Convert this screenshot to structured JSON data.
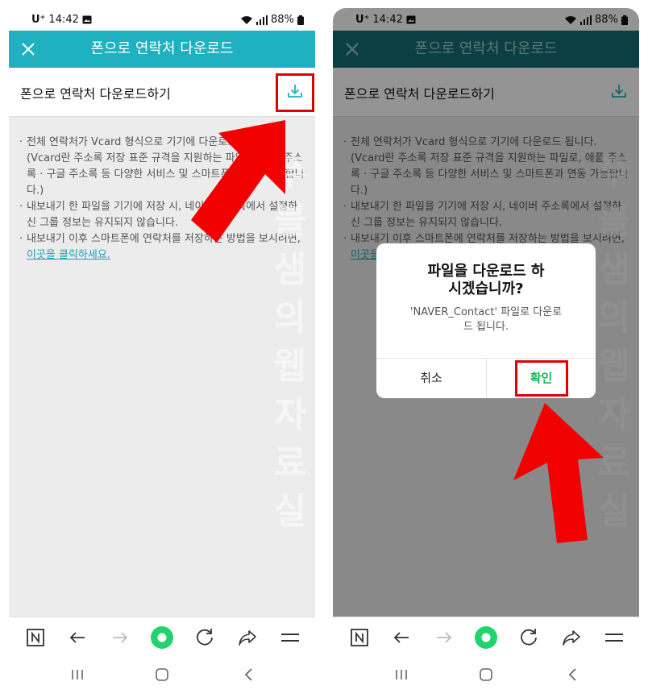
{
  "colors": {
    "accent": "#1fb1c0",
    "accent_dimmed": "#146d76",
    "link": "#1aa4b8",
    "confirm": "#11b956",
    "highlight": "#e00000",
    "home_circle": "#22d36b"
  },
  "status": {
    "carrier": "U⁺",
    "time": "14:42",
    "battery": "88%"
  },
  "appbar": {
    "title": "폰으로 연락처 다운로드",
    "close_icon": "close-icon"
  },
  "subheader": {
    "label": "폰으로 연락처 다운로드하기",
    "download_icon": "download-icon"
  },
  "content": {
    "bullet1": "전체 연락처가 Vcard 형식으로 기기에 다운로드 됩니다. (Vcard란 주소록 저장 표준 규격을 지원하는 파일로, 애플 주소록 · 구글 주소록 등 다양한 서비스 및 스마트폰과 연동 가능합니다.)",
    "bullet2": "내보내기 한 파일을 기기에 저장 시, 네이버 주소록에서 설정하신 그룹 정보는 유지되지 않습니다.",
    "bullet3_prefix": "내보내기 이후 스마트폰에 연락처를 저장하는 방법을 보시려면, ",
    "bullet3_link": "이곳을 클릭하세요."
  },
  "watermark": "쭈블샘의웹자료실",
  "dialog": {
    "title": "파일을 다운로드 하시겠습니까?",
    "message": "'NAVER_Contact' 파일로 다운로드 됩니다.",
    "cancel": "취소",
    "confirm": "확인"
  },
  "bottom_nav": [
    "naver-icon",
    "back-arrow-icon",
    "forward-arrow-icon",
    "home-circle-icon",
    "refresh-icon",
    "share-icon",
    "menu-icon"
  ],
  "system_nav": [
    "recent-apps-icon",
    "home-icon",
    "back-icon"
  ]
}
